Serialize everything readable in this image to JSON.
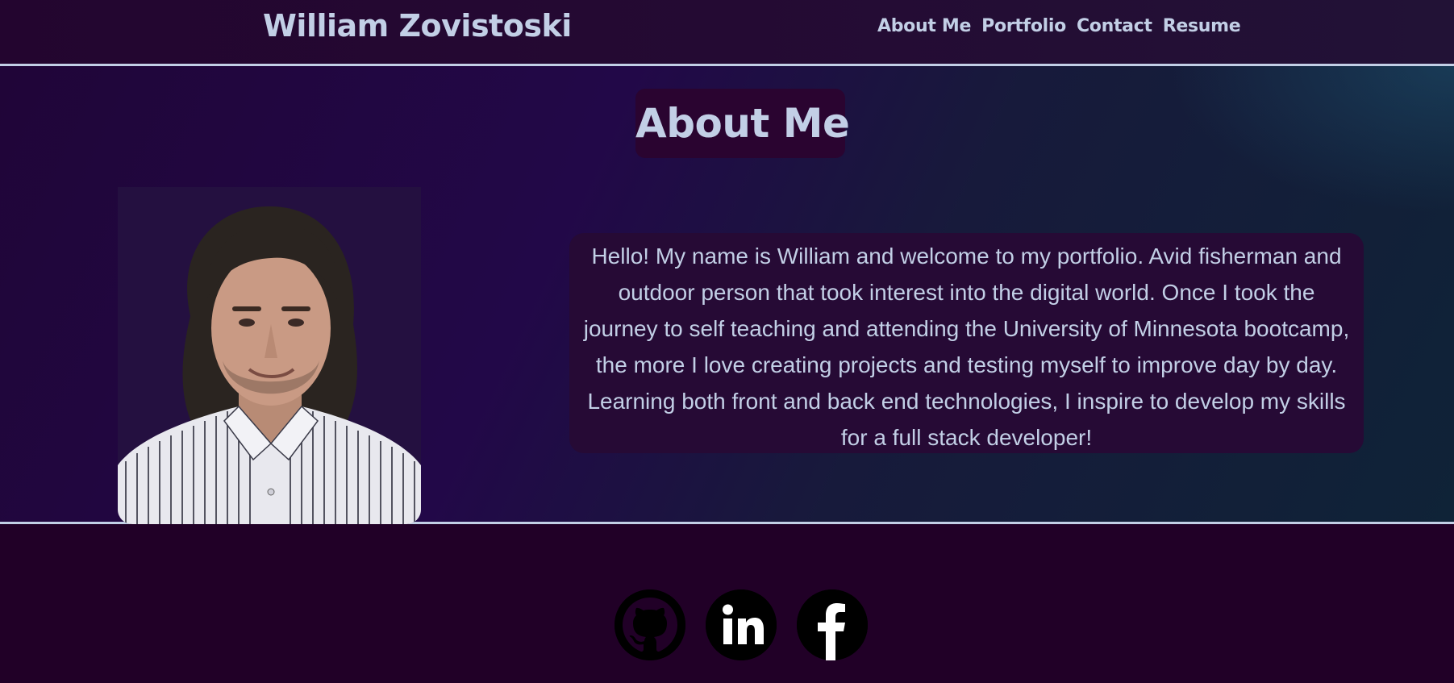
{
  "header": {
    "site_title": "William Zovistoski",
    "nav": [
      "About Me",
      "Portfolio",
      "Contact",
      "Resume"
    ]
  },
  "about": {
    "heading": "About Me",
    "bio": "Hello! My name is William and welcome to my portfolio. Avid fisherman and outdoor person that took interest into the digital world. Once I took the journey to self teaching and attending the University of Minnesota bootcamp, the more I love creating projects and testing myself to improve day by day. Learning both front and back end technologies, I inspire to develop my skills for a full stack developer!",
    "portrait_icon": "profile-photo"
  },
  "footer": {
    "social": [
      {
        "icon": "github-icon"
      },
      {
        "icon": "linkedin-icon"
      },
      {
        "icon": "facebook-icon"
      }
    ]
  },
  "colors": {
    "text": "#c2cfe6",
    "header_bg": "#23052f",
    "footer_bg": "#210027",
    "panel_bg": "#260a35",
    "icon_bg": "#000000"
  }
}
